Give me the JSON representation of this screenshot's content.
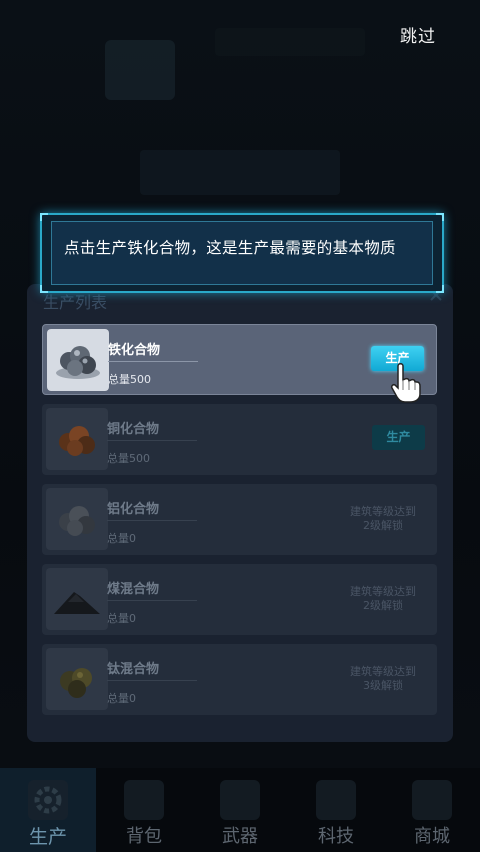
{
  "skip_label": "跳过",
  "dialog_text": "点击生产铁化合物，这是生产最需要的基本物质",
  "panel": {
    "title": "生产列表",
    "items": [
      {
        "name": "铁化合物",
        "amount": "总量500",
        "action": "生产",
        "locked": false,
        "ore_color": "#7b838f"
      },
      {
        "name": "铜化合物",
        "amount": "总量500",
        "action": "生产",
        "locked": false,
        "ore_color": "#8a4e2a"
      },
      {
        "name": "铝化合物",
        "amount": "总量0",
        "lock_line1": "建筑等级达到",
        "lock_line2": "2级解锁",
        "locked": true,
        "ore_color": "#565d66"
      },
      {
        "name": "煤混合物",
        "amount": "总量0",
        "lock_line1": "建筑等级达到",
        "lock_line2": "2级解锁",
        "locked": true,
        "ore_color": "#1d2127"
      },
      {
        "name": "钛混合物",
        "amount": "总量0",
        "lock_line1": "建筑等级达到",
        "lock_line2": "3级解锁",
        "locked": true,
        "ore_color": "#5a5330"
      }
    ]
  },
  "nav": [
    {
      "label": "生产",
      "icon": "gear-icon",
      "active": true
    },
    {
      "label": "背包",
      "icon": "backpack-icon",
      "active": false
    },
    {
      "label": "武器",
      "icon": "weapon-icon",
      "active": false
    },
    {
      "label": "科技",
      "icon": "chip-icon",
      "active": false
    },
    {
      "label": "商城",
      "icon": "shop-icon",
      "active": false
    }
  ],
  "colors": {
    "accent": "#1fb8e3",
    "dialog_border": "#2aa9c9"
  }
}
